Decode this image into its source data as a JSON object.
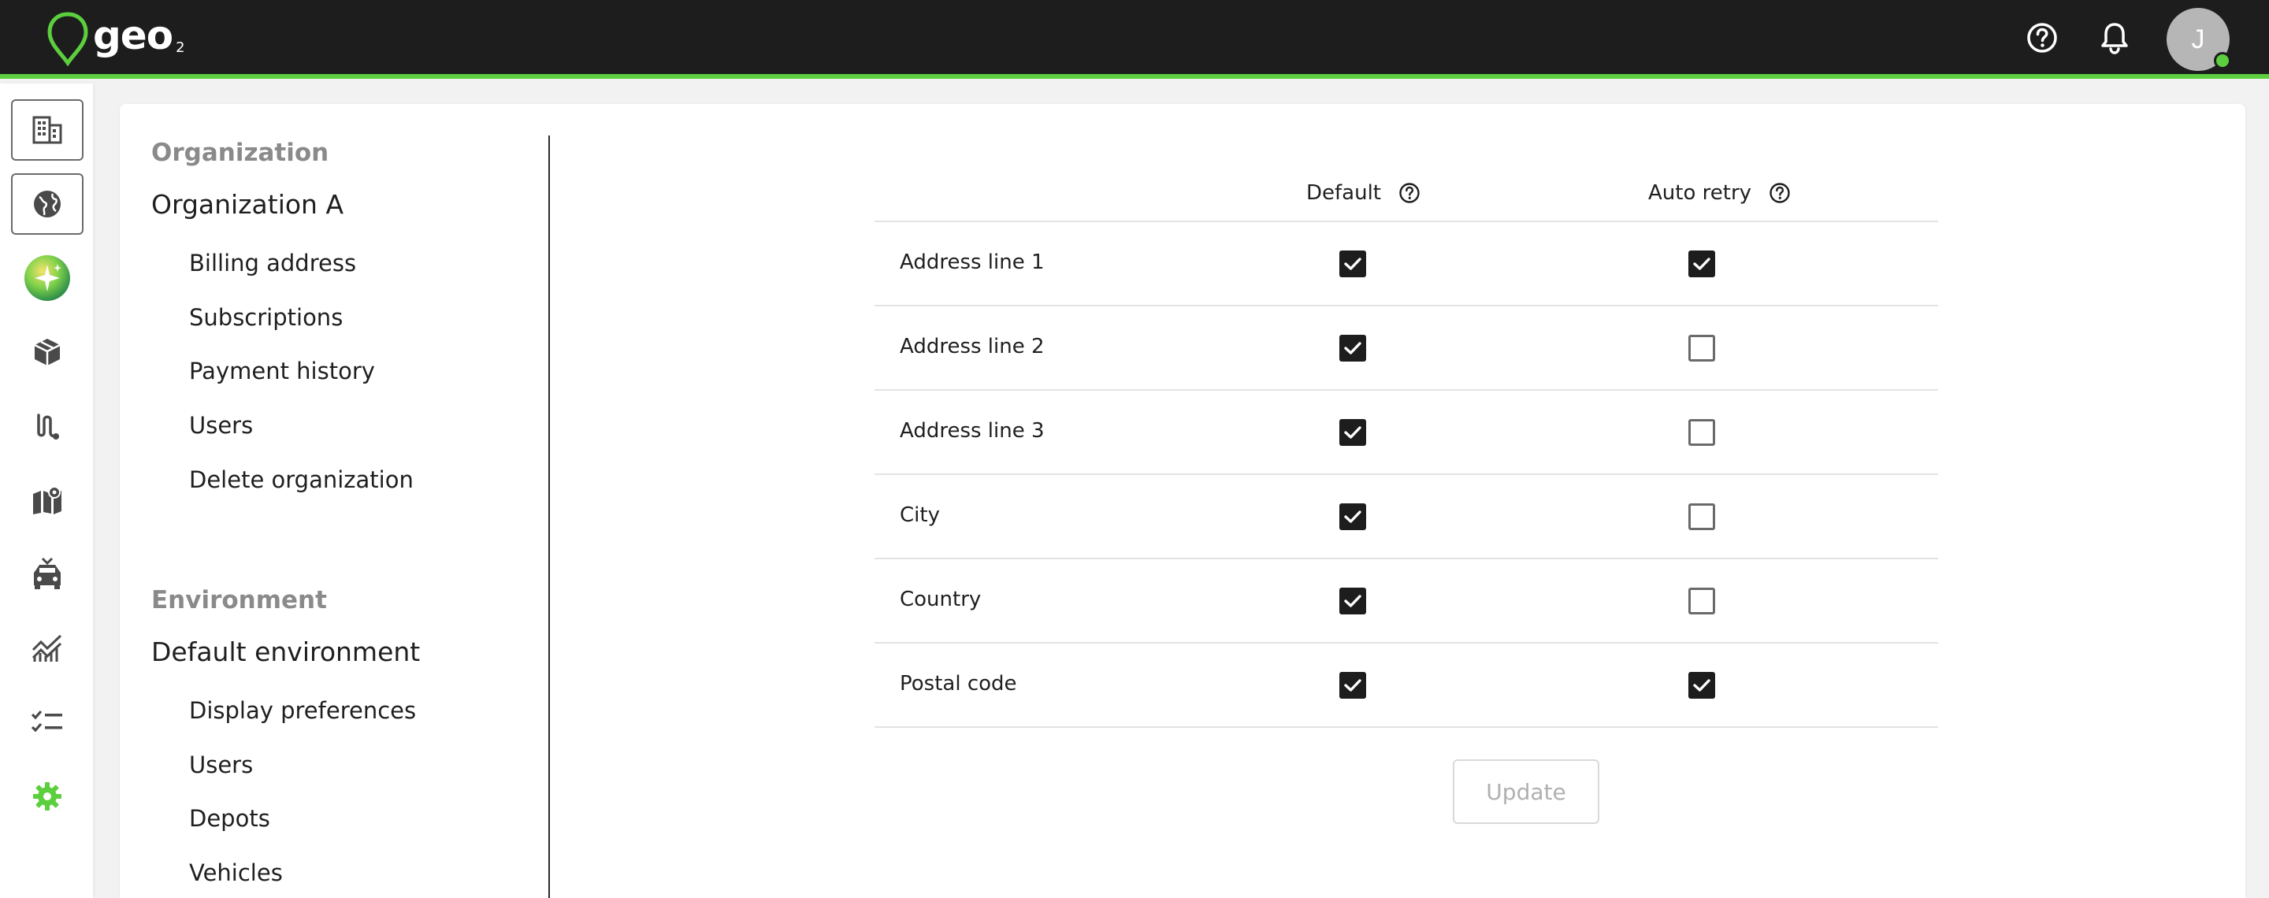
{
  "app": {
    "logo_text": "geo",
    "logo_sub": "2",
    "user_initial": "J",
    "brand_color": "#5ccf3e"
  },
  "header": {
    "icons": [
      "help-icon",
      "notification-bell-icon"
    ]
  },
  "rail": {
    "items": [
      {
        "icon": "building-icon",
        "state": "boxed"
      },
      {
        "icon": "globe-icon",
        "state": "boxed"
      },
      {
        "icon": "sparkle-icon",
        "state": "normal"
      },
      {
        "icon": "package-icon",
        "state": "normal"
      },
      {
        "icon": "route-icon",
        "state": "normal"
      },
      {
        "icon": "map-icon",
        "state": "normal"
      },
      {
        "icon": "vehicle-icon",
        "state": "normal"
      },
      {
        "icon": "analytics-icon",
        "state": "normal"
      },
      {
        "icon": "checklist-icon",
        "state": "normal"
      },
      {
        "icon": "settings-gear-icon",
        "state": "active"
      }
    ]
  },
  "settings_nav": {
    "organization": {
      "section_title": "Organization",
      "name": "Organization A",
      "links": [
        "Billing address",
        "Subscriptions",
        "Payment history",
        "Users",
        "Delete organization"
      ]
    },
    "environment": {
      "section_title": "Environment",
      "name": "Default environment",
      "links": [
        "Display preferences",
        "Users",
        "Depots",
        "Vehicles"
      ]
    }
  },
  "table": {
    "columns": {
      "default": "Default",
      "auto_retry": "Auto retry"
    },
    "rows": [
      {
        "label": "Address line 1",
        "default": true,
        "auto_retry": true
      },
      {
        "label": "Address line 2",
        "default": true,
        "auto_retry": false
      },
      {
        "label": "Address line 3",
        "default": true,
        "auto_retry": false
      },
      {
        "label": "City",
        "default": true,
        "auto_retry": false
      },
      {
        "label": "Country",
        "default": true,
        "auto_retry": false
      },
      {
        "label": "Postal code",
        "default": true,
        "auto_retry": true
      }
    ]
  },
  "actions": {
    "update_label": "Update",
    "update_enabled": false
  }
}
